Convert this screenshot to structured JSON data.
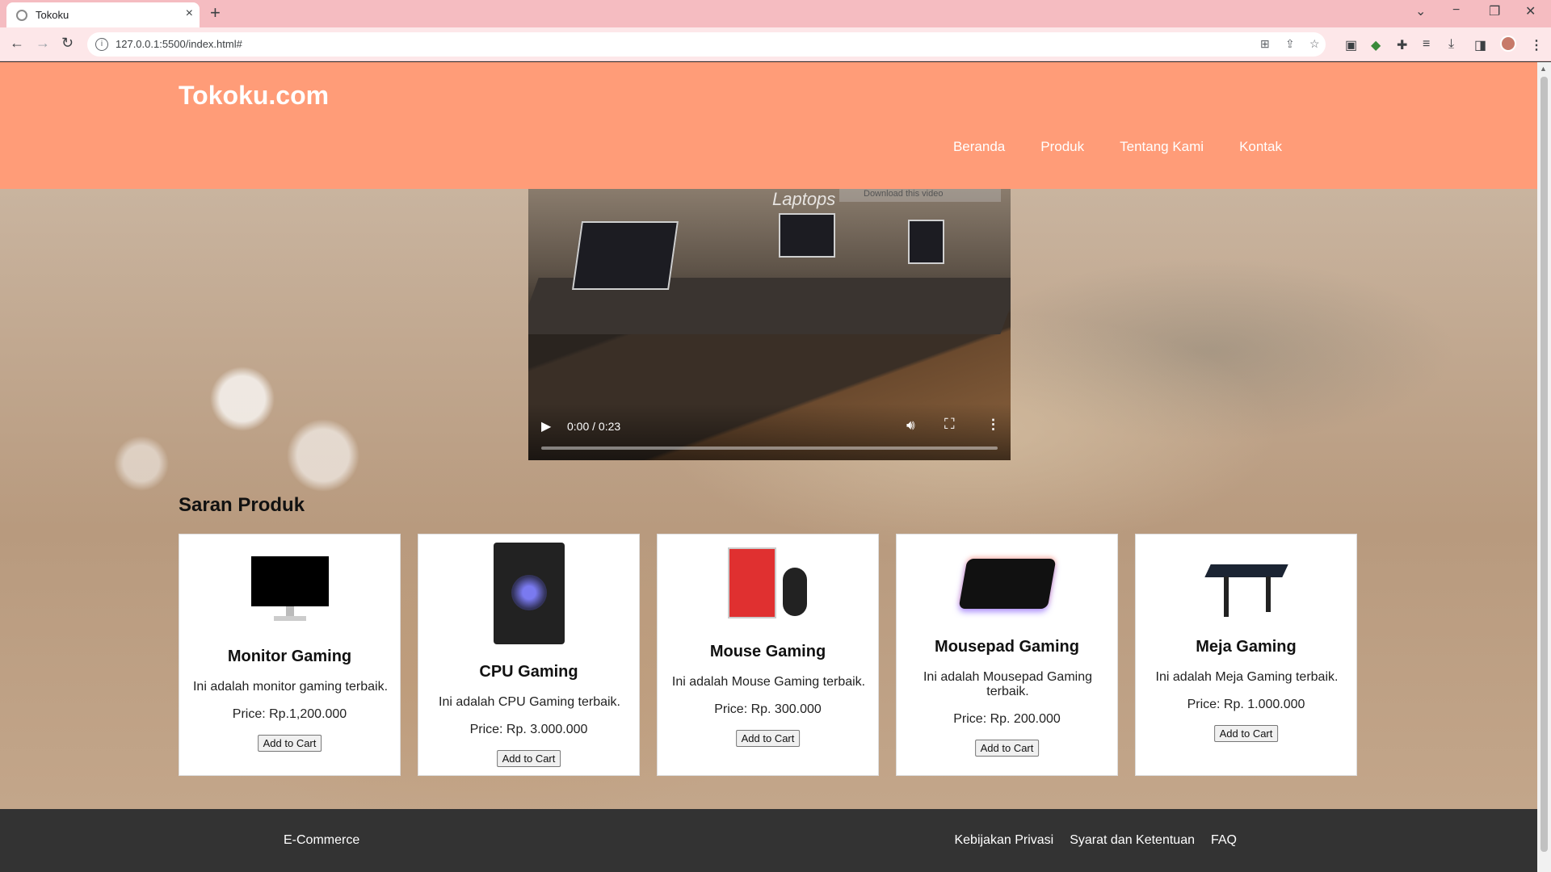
{
  "browser": {
    "tab_title": "Tokoku",
    "url": "127.0.0.1:5500/index.html#",
    "new_tab": "+",
    "close_tab": "×"
  },
  "site": {
    "logo": "Tokoku.com",
    "nav": [
      "Beranda",
      "Produk",
      "Tentang Kami",
      "Kontak"
    ]
  },
  "video": {
    "caption": "Laptops",
    "download_text": "Download this video",
    "time": "0:00 / 0:23"
  },
  "section_title": "Saran Produk",
  "products": [
    {
      "name": "Monitor Gaming",
      "desc": "Ini adalah monitor gaming terbaik.",
      "price": "Price: Rp.1,200.000",
      "button": "Add to Cart"
    },
    {
      "name": "CPU Gaming",
      "desc": "Ini adalah CPU Gaming terbaik.",
      "price": "Price: Rp. 3.000.000",
      "button": "Add to Cart"
    },
    {
      "name": "Mouse Gaming",
      "desc": "Ini adalah Mouse Gaming terbaik.",
      "price": "Price: Rp. 300.000",
      "button": "Add to Cart"
    },
    {
      "name": "Mousepad Gaming",
      "desc": "Ini adalah Mousepad Gaming terbaik.",
      "price": "Price: Rp. 200.000",
      "button": "Add to Cart"
    },
    {
      "name": "Meja Gaming",
      "desc": "Ini adalah Meja Gaming terbaik.",
      "price": "Price: Rp. 1.000.000",
      "button": "Add to Cart"
    }
  ],
  "footer": {
    "left": "E-Commerce",
    "links": [
      "Kebijakan Privasi",
      "Syarat dan Ketentuan",
      "FAQ"
    ]
  },
  "colors": {
    "header": "#ff9c78",
    "tabbar": "#f5bcc1",
    "footer": "#333333"
  }
}
